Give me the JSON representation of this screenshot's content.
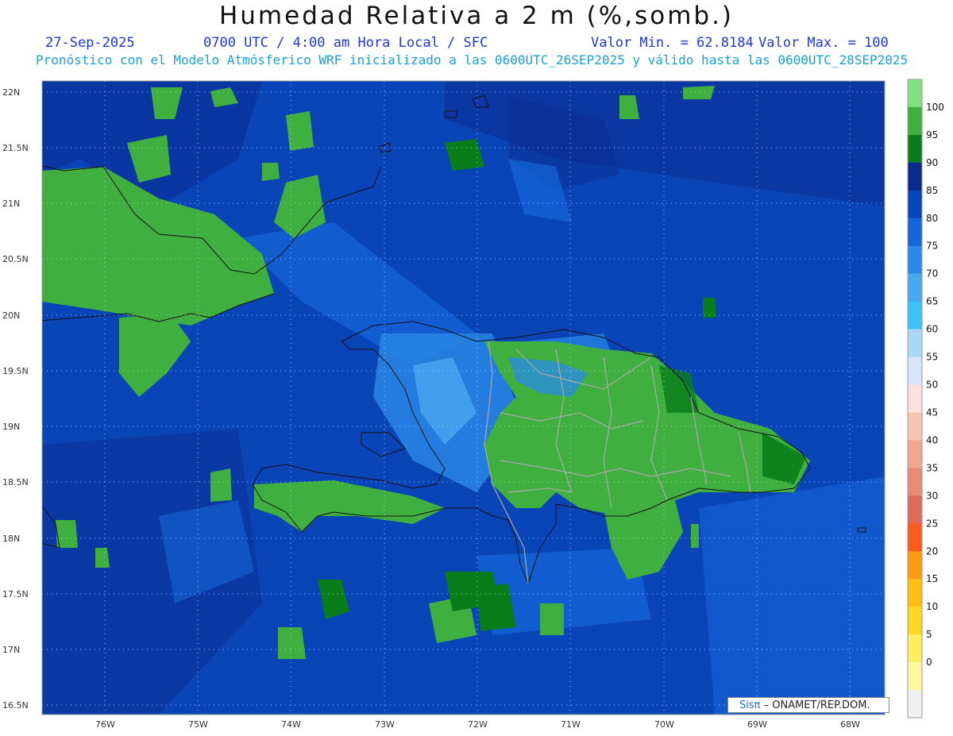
{
  "header": {
    "title": "Humedad Relativa a 2 m (%,somb.)",
    "date": "27-Sep-2025",
    "time": "0700 UTC / 4:00 am Hora Local / SFC",
    "min_label": "Valor Min. = 62.8184",
    "max_label": "Valor Max. = 100",
    "forecast_line": "Pronóstico con el Modelo Atmósferico WRF inicializado a las 0600UTC_26SEP2025 y válido hasta las  0600UTC_28SEP2025"
  },
  "map": {
    "lat_labels": [
      "22N",
      "21.5N",
      "21N",
      "20.5N",
      "20N",
      "19.5N",
      "19N",
      "18.5N",
      "18N",
      "17.5N",
      "17N",
      "16.5N"
    ],
    "lon_labels": [
      "76W",
      "75W",
      "74W",
      "73W",
      "72W",
      "71W",
      "70W",
      "69W",
      "68W"
    ]
  },
  "colorbar": {
    "levels": [
      "100",
      "95",
      "90",
      "85",
      "80",
      "75",
      "70",
      "65",
      "60",
      "55",
      "50",
      "45",
      "40",
      "35",
      "30",
      "25",
      "20",
      "15",
      "10",
      "5",
      "0"
    ],
    "colors": [
      "#7ee07e",
      "#3fb03f",
      "#0a7c1a",
      "#0a2a8c",
      "#0a45b8",
      "#1466d8",
      "#2a8ae8",
      "#48a8f0",
      "#3ec0f8",
      "#a8d8f8",
      "#d8e4f8",
      "#fbe0e0",
      "#f6c4b0",
      "#f0a890",
      "#e88a78",
      "#e06a5a",
      "#ff5a20",
      "#ff9a10",
      "#ffbe10",
      "#ffd820",
      "#ffee60",
      "#fff8a0",
      "#f0f0f0"
    ]
  },
  "credit": {
    "brand": "Sisπ",
    "text": "– ONAMET/REP.DOM."
  }
}
